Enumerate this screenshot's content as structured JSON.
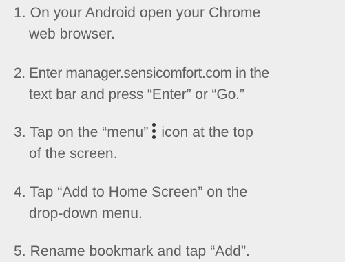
{
  "steps": [
    {
      "number": "1.",
      "line1": "On your Android open your Chrome",
      "line2": "web browser."
    },
    {
      "number": "2.",
      "line1": "Enter manager.sensicomfort.com in the",
      "line2": "text bar and press “Enter” or “Go.”"
    },
    {
      "number": "3.",
      "line1_before_icon": "Tap on the “menu”",
      "icon": "vertical-dots-menu-icon",
      "line1_after_icon": "icon at the top",
      "line2": "of the screen."
    },
    {
      "number": "4.",
      "line1": "Tap “Add to Home Screen” on the",
      "line2": "drop-down menu."
    },
    {
      "number": "5.",
      "line1": "Rename bookmark and tap “Add”."
    }
  ],
  "colors": {
    "background": "#eeeeee",
    "text": "#5f5f5f",
    "icon": "#333333"
  }
}
